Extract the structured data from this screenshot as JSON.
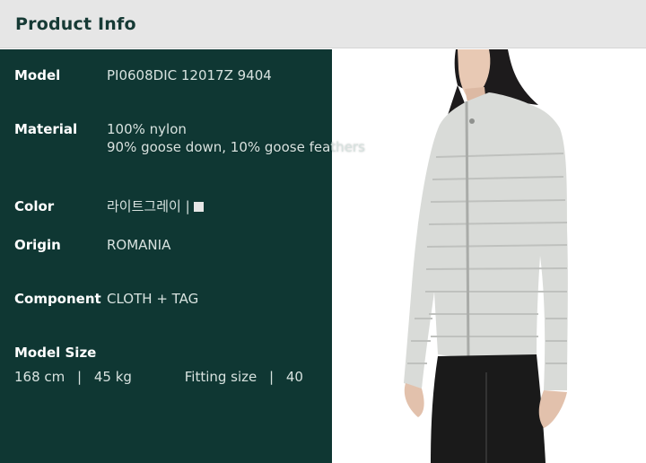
{
  "header": {
    "title": "Product Info"
  },
  "info": {
    "model": {
      "label": "Model",
      "value": "PI0608DIC 12017Z 9404"
    },
    "material": {
      "label": "Material",
      "line1": "100% nylon",
      "line2": "90% goose down, 10% goose feathers"
    },
    "color": {
      "label": "Color",
      "value": "라이트그레이 |",
      "swatch_color": "#e6e6e6"
    },
    "origin": {
      "label": "Origin",
      "value": "ROMANIA"
    },
    "component": {
      "label": "Component",
      "value": "CLOTH + TAG"
    },
    "model_size": {
      "label": "Model Size",
      "height": "168 cm",
      "sep1": "|",
      "weight": "45 kg",
      "fitting_label": "Fitting size",
      "sep2": "|",
      "fitting_value": "40"
    }
  },
  "colors": {
    "panel_bg": "#0f3733",
    "header_bg": "#e6e6e6",
    "header_text": "#163a35"
  }
}
